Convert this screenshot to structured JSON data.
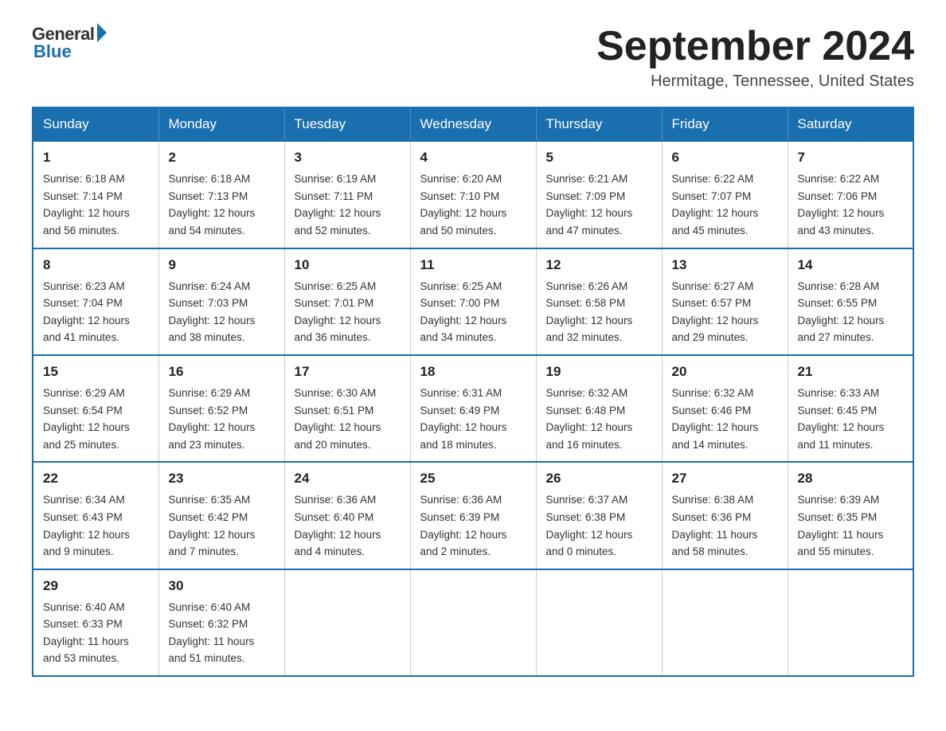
{
  "logo": {
    "general": "General",
    "blue": "Blue"
  },
  "title": "September 2024",
  "location": "Hermitage, Tennessee, United States",
  "headers": [
    "Sunday",
    "Monday",
    "Tuesday",
    "Wednesday",
    "Thursday",
    "Friday",
    "Saturday"
  ],
  "weeks": [
    [
      {
        "day": "1",
        "sunrise": "6:18 AM",
        "sunset": "7:14 PM",
        "daylight": "12 hours and 56 minutes."
      },
      {
        "day": "2",
        "sunrise": "6:18 AM",
        "sunset": "7:13 PM",
        "daylight": "12 hours and 54 minutes."
      },
      {
        "day": "3",
        "sunrise": "6:19 AM",
        "sunset": "7:11 PM",
        "daylight": "12 hours and 52 minutes."
      },
      {
        "day": "4",
        "sunrise": "6:20 AM",
        "sunset": "7:10 PM",
        "daylight": "12 hours and 50 minutes."
      },
      {
        "day": "5",
        "sunrise": "6:21 AM",
        "sunset": "7:09 PM",
        "daylight": "12 hours and 47 minutes."
      },
      {
        "day": "6",
        "sunrise": "6:22 AM",
        "sunset": "7:07 PM",
        "daylight": "12 hours and 45 minutes."
      },
      {
        "day": "7",
        "sunrise": "6:22 AM",
        "sunset": "7:06 PM",
        "daylight": "12 hours and 43 minutes."
      }
    ],
    [
      {
        "day": "8",
        "sunrise": "6:23 AM",
        "sunset": "7:04 PM",
        "daylight": "12 hours and 41 minutes."
      },
      {
        "day": "9",
        "sunrise": "6:24 AM",
        "sunset": "7:03 PM",
        "daylight": "12 hours and 38 minutes."
      },
      {
        "day": "10",
        "sunrise": "6:25 AM",
        "sunset": "7:01 PM",
        "daylight": "12 hours and 36 minutes."
      },
      {
        "day": "11",
        "sunrise": "6:25 AM",
        "sunset": "7:00 PM",
        "daylight": "12 hours and 34 minutes."
      },
      {
        "day": "12",
        "sunrise": "6:26 AM",
        "sunset": "6:58 PM",
        "daylight": "12 hours and 32 minutes."
      },
      {
        "day": "13",
        "sunrise": "6:27 AM",
        "sunset": "6:57 PM",
        "daylight": "12 hours and 29 minutes."
      },
      {
        "day": "14",
        "sunrise": "6:28 AM",
        "sunset": "6:55 PM",
        "daylight": "12 hours and 27 minutes."
      }
    ],
    [
      {
        "day": "15",
        "sunrise": "6:29 AM",
        "sunset": "6:54 PM",
        "daylight": "12 hours and 25 minutes."
      },
      {
        "day": "16",
        "sunrise": "6:29 AM",
        "sunset": "6:52 PM",
        "daylight": "12 hours and 23 minutes."
      },
      {
        "day": "17",
        "sunrise": "6:30 AM",
        "sunset": "6:51 PM",
        "daylight": "12 hours and 20 minutes."
      },
      {
        "day": "18",
        "sunrise": "6:31 AM",
        "sunset": "6:49 PM",
        "daylight": "12 hours and 18 minutes."
      },
      {
        "day": "19",
        "sunrise": "6:32 AM",
        "sunset": "6:48 PM",
        "daylight": "12 hours and 16 minutes."
      },
      {
        "day": "20",
        "sunrise": "6:32 AM",
        "sunset": "6:46 PM",
        "daylight": "12 hours and 14 minutes."
      },
      {
        "day": "21",
        "sunrise": "6:33 AM",
        "sunset": "6:45 PM",
        "daylight": "12 hours and 11 minutes."
      }
    ],
    [
      {
        "day": "22",
        "sunrise": "6:34 AM",
        "sunset": "6:43 PM",
        "daylight": "12 hours and 9 minutes."
      },
      {
        "day": "23",
        "sunrise": "6:35 AM",
        "sunset": "6:42 PM",
        "daylight": "12 hours and 7 minutes."
      },
      {
        "day": "24",
        "sunrise": "6:36 AM",
        "sunset": "6:40 PM",
        "daylight": "12 hours and 4 minutes."
      },
      {
        "day": "25",
        "sunrise": "6:36 AM",
        "sunset": "6:39 PM",
        "daylight": "12 hours and 2 minutes."
      },
      {
        "day": "26",
        "sunrise": "6:37 AM",
        "sunset": "6:38 PM",
        "daylight": "12 hours and 0 minutes."
      },
      {
        "day": "27",
        "sunrise": "6:38 AM",
        "sunset": "6:36 PM",
        "daylight": "11 hours and 58 minutes."
      },
      {
        "day": "28",
        "sunrise": "6:39 AM",
        "sunset": "6:35 PM",
        "daylight": "11 hours and 55 minutes."
      }
    ],
    [
      {
        "day": "29",
        "sunrise": "6:40 AM",
        "sunset": "6:33 PM",
        "daylight": "11 hours and 53 minutes."
      },
      {
        "day": "30",
        "sunrise": "6:40 AM",
        "sunset": "6:32 PM",
        "daylight": "11 hours and 51 minutes."
      },
      null,
      null,
      null,
      null,
      null
    ]
  ],
  "labels": {
    "sunrise": "Sunrise:",
    "sunset": "Sunset:",
    "daylight": "Daylight:"
  }
}
